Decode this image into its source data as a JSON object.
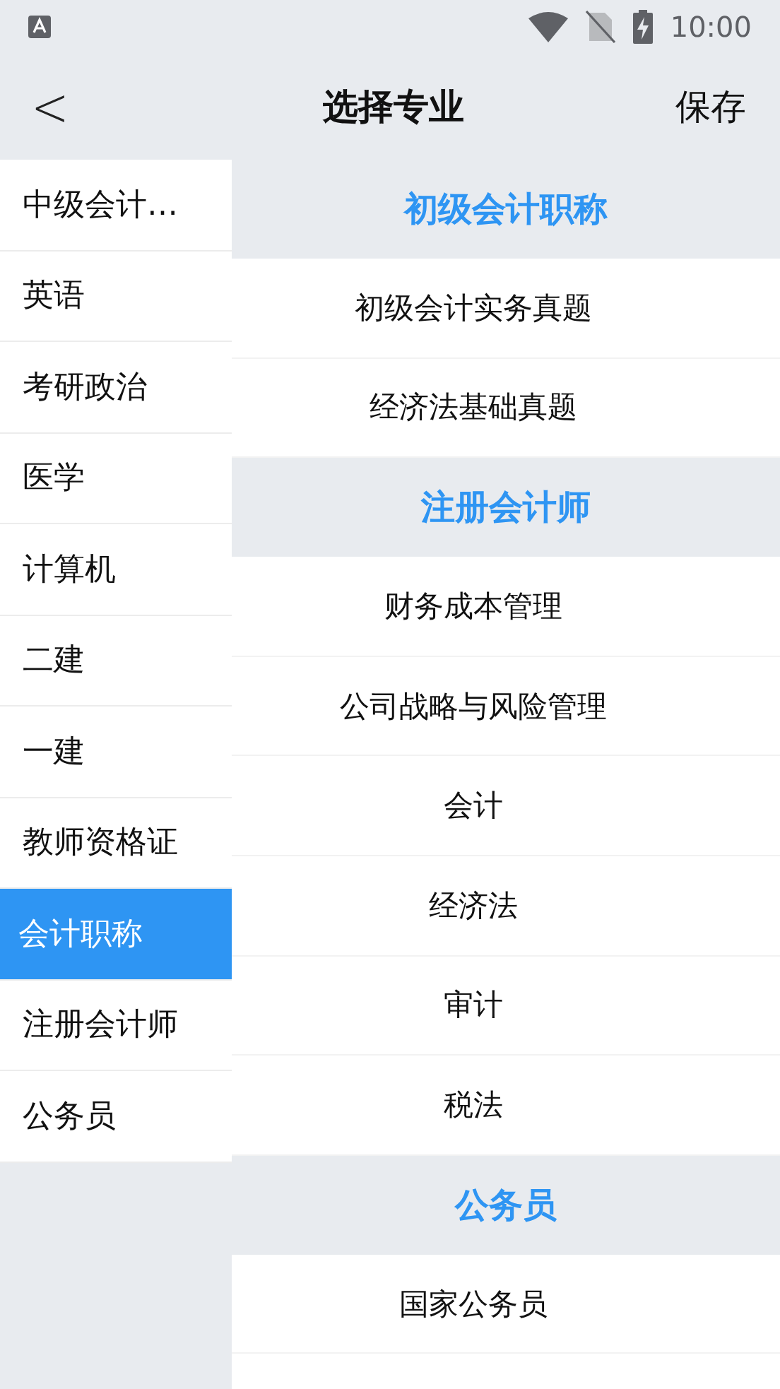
{
  "status_bar": {
    "time": "10:00"
  },
  "header": {
    "back": "<",
    "title": "选择专业",
    "action": "保存"
  },
  "sidebar": {
    "items": [
      {
        "label": "中级会计…",
        "selected": false
      },
      {
        "label": "英语",
        "selected": false
      },
      {
        "label": "考研政治",
        "selected": false
      },
      {
        "label": "医学",
        "selected": false
      },
      {
        "label": "计算机",
        "selected": false
      },
      {
        "label": "二建",
        "selected": false
      },
      {
        "label": "一建",
        "selected": false
      },
      {
        "label": "教师资格证",
        "selected": false
      },
      {
        "label": "会计职称",
        "selected": true
      },
      {
        "label": "注册会计师",
        "selected": false
      },
      {
        "label": "公务员",
        "selected": false
      }
    ]
  },
  "sections": [
    {
      "title": "初级会计职称",
      "items": [
        "初级会计实务真题",
        "经济法基础真题"
      ]
    },
    {
      "title": "注册会计师",
      "items": [
        "财务成本管理",
        "公司战略与风险管理",
        "会计",
        "经济法",
        "审计",
        "税法"
      ]
    },
    {
      "title": "公务员",
      "items": [
        "国家公务员"
      ]
    }
  ]
}
